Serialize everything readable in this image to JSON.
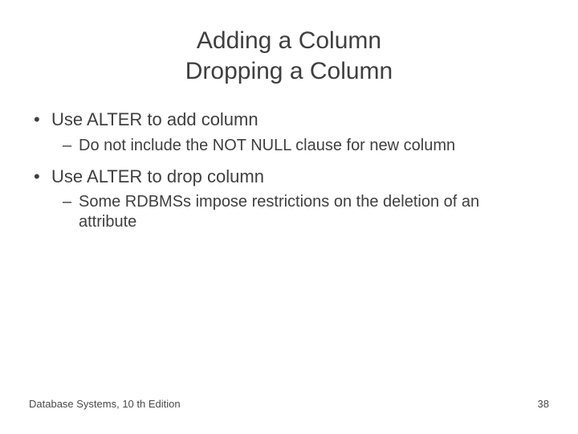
{
  "title_line1": "Adding a Column",
  "title_line2": "Dropping a Column",
  "bullets": {
    "b1": "Use ALTER to add column",
    "b1_sub": "Do not include the NOT NULL clause for new column",
    "b2": "Use ALTER to drop column",
    "b2_sub": "Some RDBMSs impose restrictions on the deletion of an attribute"
  },
  "footer": {
    "left": "Database Systems, 10 th Edition",
    "right": "38"
  }
}
